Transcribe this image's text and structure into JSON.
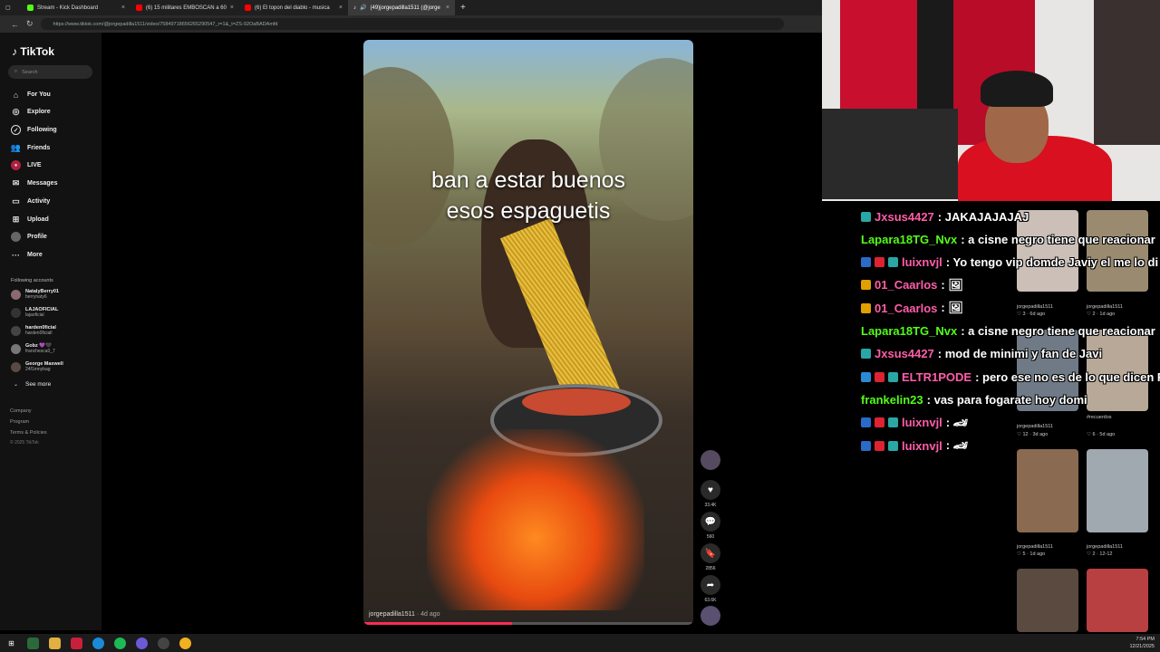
{
  "browser": {
    "tabs": [
      {
        "label": "Stream - Kick Dashboard",
        "color": "#53fc18",
        "active": false
      },
      {
        "label": "(6) 15 militares EMBOSCAN a 60",
        "color": "#ff0000",
        "active": false
      },
      {
        "label": "(6) El topon del diablo - musica",
        "color": "#ff0000",
        "active": false
      },
      {
        "label": "(49)jorgepadilla1511 (@jorge",
        "color": "#ffffff",
        "active": true
      }
    ],
    "url": "https://www.tiktok.com/@jorgepadilla1511/video/75849718656265290547_r=1&_t=ZS-92OaBADAmfd"
  },
  "sidebar": {
    "logo": "TikTok",
    "search_placeholder": "Search",
    "nav": [
      {
        "label": "For You",
        "icon": "home-icon"
      },
      {
        "label": "Explore",
        "icon": "compass-icon"
      },
      {
        "label": "Following",
        "icon": "following-icon"
      },
      {
        "label": "Friends",
        "icon": "friends-icon"
      },
      {
        "label": "LIVE",
        "icon": "live-icon"
      },
      {
        "label": "Messages",
        "icon": "messages-icon"
      },
      {
        "label": "Activity",
        "icon": "activity-icon"
      },
      {
        "label": "Upload",
        "icon": "upload-icon"
      },
      {
        "label": "Profile",
        "icon": "profile-icon"
      },
      {
        "label": "More",
        "icon": "more-icon"
      }
    ],
    "following_header": "Following accounts",
    "accounts": [
      {
        "name": "NatalyBerry01",
        "handle": "berrynaty6"
      },
      {
        "name": "LAJAOFICIAL",
        "handle": "lajaoficial"
      },
      {
        "name": "harden0ficial",
        "handle": "harden0ficiall"
      },
      {
        "name": "Gobz 💜🖤",
        "handle": "franchesca0_7"
      },
      {
        "name": "George Maxwell",
        "handle": "24f1mnybag"
      }
    ],
    "see_more": "See more",
    "footer": [
      "Company",
      "Program",
      "Terms & Policies",
      "© 2025 TikTok"
    ]
  },
  "video": {
    "caption_line1": "ban a estar buenos",
    "caption_line2": "esos espaguetis",
    "author": "jorgepadilla1511",
    "time_ago": "· 4d ago",
    "progress": 0.45
  },
  "actions": {
    "likes": "33.4K",
    "comments": "560",
    "saves": "2856",
    "shares": "63.6K"
  },
  "chat": [
    {
      "user": "Jxsus4427",
      "color": "#ff5ea8",
      "text": ": JAKAJAJAJAJ",
      "badges": [
        "#2aa6a6"
      ]
    },
    {
      "user": "Lapara18TG_Nvx",
      "color": "#53fc18",
      "text": ": a cisne negro tiene que reacionar",
      "badges": []
    },
    {
      "user": "luixnvjl",
      "color": "#ff5ea8",
      "text": ": Yo tengo vip domde Javiy el me lo di",
      "badges": [
        "#2a6ac8",
        "#d23",
        "#2aa6a6"
      ]
    },
    {
      "user": "01_Caarlos",
      "color": "#ff5ea8",
      "text": ": 🖼",
      "badges": [
        "#e0a000"
      ]
    },
    {
      "user": "01_Caarlos",
      "color": "#ff5ea8",
      "text": ": 🖼",
      "badges": [
        "#e0a000"
      ]
    },
    {
      "user": "Lapara18TG_Nvx",
      "color": "#53fc18",
      "text": ": a cisne negro tiene que reacionar",
      "badges": []
    },
    {
      "user": "Jxsus4427",
      "color": "#ff5ea8",
      "text": ": mod de minimi y fan de Javi",
      "badges": [
        "#2aa6a6"
      ]
    },
    {
      "user": "ELTR1PODE",
      "color": "#ff5ea8",
      "text": ": pero ese no es de lo que dicen RDE",
      "badges": [
        "#2a8ad8",
        "#d23",
        "#2aa6a6"
      ]
    },
    {
      "user": "frankelin23",
      "color": "#53fc18",
      "text": ": vas para fogarate hoy domi",
      "badges": []
    },
    {
      "user": "luixnvjl",
      "color": "#ff5ea8",
      "text": ": 🏎",
      "badges": [
        "#2a6ac8",
        "#d23",
        "#2aa6a6"
      ]
    },
    {
      "user": "luixnvjl",
      "color": "#ff5ea8",
      "text": ": 🏎",
      "badges": [
        "#2a6ac8",
        "#d23",
        "#2aa6a6"
      ]
    }
  ],
  "profile_videos": [
    {
      "author": "jorgepadilla1511",
      "meta": "♡ 3 · 6d ago",
      "color": "#cbbfb8"
    },
    {
      "author": "jorgepadilla1511",
      "meta": "♡ 2 · 1d ago",
      "color": "#9a8a70"
    },
    {
      "author": "jorgepadilla1511",
      "meta": "♡ 12 · 3d ago",
      "color": "#6f7a86"
    },
    {
      "author": "#recuerdos",
      "meta": "♡ 6 · 5d ago",
      "color": "#b8a898"
    },
    {
      "author": "jorgepadilla1511",
      "meta": "♡ 5 · 1d ago",
      "color": "#8a6a50"
    },
    {
      "author": "jorgepadilla1511",
      "meta": "♡ 2 · 12-12",
      "color": "#a0a8b0"
    },
    {
      "author": "",
      "meta": "",
      "color": "#5a4a40"
    },
    {
      "author": "",
      "meta": "",
      "color": "#b84040"
    }
  ],
  "tray": {
    "time": "7:54 PM",
    "date": "12/21/2025"
  }
}
